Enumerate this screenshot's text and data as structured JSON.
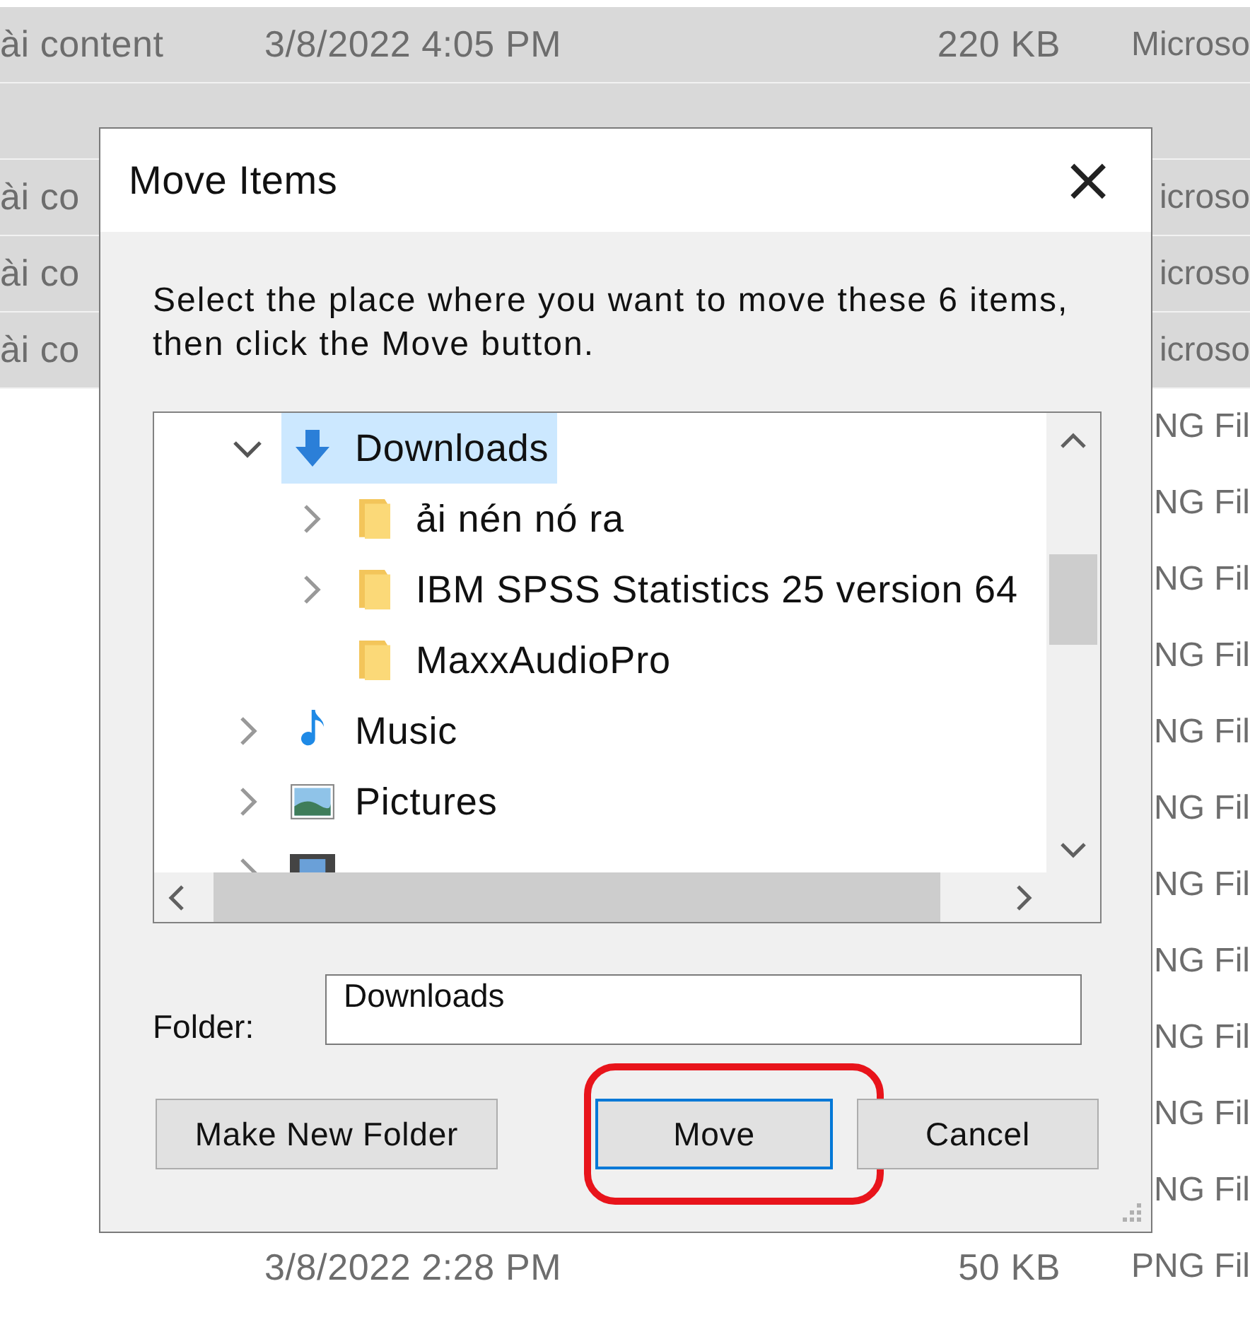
{
  "file_list": {
    "rows": [
      {
        "name": "ài content",
        "date": "3/8/2022 4:05 PM",
        "size": "220 KB",
        "type": "Microso",
        "selected": true
      },
      {
        "selected": true
      },
      {
        "name": "ài co",
        "type": "icroso",
        "selected": true
      },
      {
        "name": "ài co",
        "type": "icroso",
        "selected": true
      },
      {
        "name": "ài co",
        "type": "icroso",
        "selected": true
      },
      {
        "type": "NG Fil",
        "selected": false
      },
      {
        "type": "NG Fil",
        "selected": false
      },
      {
        "type": "NG Fil",
        "selected": false
      },
      {
        "type": "NG Fil",
        "selected": false
      },
      {
        "type": "NG Fil",
        "selected": false
      },
      {
        "type": "NG Fil",
        "selected": false
      },
      {
        "type": "NG Fil",
        "selected": false
      },
      {
        "type": "NG Fil",
        "selected": false
      },
      {
        "type": "NG Fil",
        "selected": false
      },
      {
        "type": "NG Fil",
        "selected": false
      },
      {
        "type": "NG Fil",
        "selected": false
      },
      {
        "date": "3/8/2022 2:28 PM",
        "size": "50 KB",
        "type": "PNG Fil",
        "selected": false
      }
    ]
  },
  "dialog": {
    "title": "Move Items",
    "close": "×",
    "message": "Select the place where you want to move these 6 items, then click the Move button.",
    "tree": [
      {
        "label": "Downloads",
        "kind": "download",
        "expanded": true,
        "has_children": true,
        "selected": true,
        "children": [
          {
            "label": "ải nén nó ra",
            "kind": "folder",
            "expanded": false,
            "has_children": true,
            "selected": false
          },
          {
            "label": "IBM SPSS Statistics 25 version 64",
            "kind": "folder",
            "expanded": false,
            "has_children": true,
            "selected": false
          },
          {
            "label": "MaxxAudioPro",
            "kind": "folder",
            "expanded": false,
            "has_children": false,
            "selected": false
          }
        ]
      },
      {
        "label": "Music",
        "kind": "music",
        "expanded": false,
        "has_children": true,
        "selected": false
      },
      {
        "label": "Pictures",
        "kind": "pictures",
        "expanded": false,
        "has_children": true,
        "selected": false
      },
      {
        "kind": "videos",
        "expanded": false,
        "has_children": true,
        "selected": false
      }
    ],
    "folder_label": "Folder:",
    "folder_value": "Downloads",
    "buttons": [
      {
        "label": "Make New Folder",
        "focused": false,
        "highlighted": false
      },
      {
        "label": "Move",
        "focused": true,
        "highlighted": true
      },
      {
        "label": "Cancel",
        "focused": false,
        "highlighted": false
      }
    ]
  }
}
